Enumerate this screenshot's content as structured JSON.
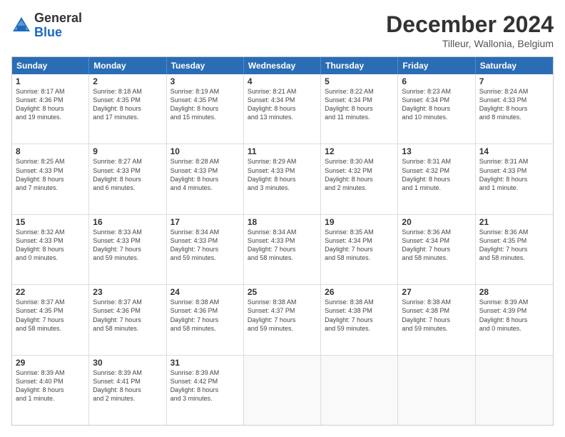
{
  "header": {
    "logo_general": "General",
    "logo_blue": "Blue",
    "month_title": "December 2024",
    "subtitle": "Tilleur, Wallonia, Belgium"
  },
  "days_of_week": [
    "Sunday",
    "Monday",
    "Tuesday",
    "Wednesday",
    "Thursday",
    "Friday",
    "Saturday"
  ],
  "weeks": [
    [
      {
        "day": "1",
        "lines": [
          "Sunrise: 8:17 AM",
          "Sunset: 4:36 PM",
          "Daylight: 8 hours",
          "and 19 minutes."
        ]
      },
      {
        "day": "2",
        "lines": [
          "Sunrise: 8:18 AM",
          "Sunset: 4:35 PM",
          "Daylight: 8 hours",
          "and 17 minutes."
        ]
      },
      {
        "day": "3",
        "lines": [
          "Sunrise: 8:19 AM",
          "Sunset: 4:35 PM",
          "Daylight: 8 hours",
          "and 15 minutes."
        ]
      },
      {
        "day": "4",
        "lines": [
          "Sunrise: 8:21 AM",
          "Sunset: 4:34 PM",
          "Daylight: 8 hours",
          "and 13 minutes."
        ]
      },
      {
        "day": "5",
        "lines": [
          "Sunrise: 8:22 AM",
          "Sunset: 4:34 PM",
          "Daylight: 8 hours",
          "and 11 minutes."
        ]
      },
      {
        "day": "6",
        "lines": [
          "Sunrise: 8:23 AM",
          "Sunset: 4:34 PM",
          "Daylight: 8 hours",
          "and 10 minutes."
        ]
      },
      {
        "day": "7",
        "lines": [
          "Sunrise: 8:24 AM",
          "Sunset: 4:33 PM",
          "Daylight: 8 hours",
          "and 8 minutes."
        ]
      }
    ],
    [
      {
        "day": "8",
        "lines": [
          "Sunrise: 8:25 AM",
          "Sunset: 4:33 PM",
          "Daylight: 8 hours",
          "and 7 minutes."
        ]
      },
      {
        "day": "9",
        "lines": [
          "Sunrise: 8:27 AM",
          "Sunset: 4:33 PM",
          "Daylight: 8 hours",
          "and 6 minutes."
        ]
      },
      {
        "day": "10",
        "lines": [
          "Sunrise: 8:28 AM",
          "Sunset: 4:33 PM",
          "Daylight: 8 hours",
          "and 4 minutes."
        ]
      },
      {
        "day": "11",
        "lines": [
          "Sunrise: 8:29 AM",
          "Sunset: 4:33 PM",
          "Daylight: 8 hours",
          "and 3 minutes."
        ]
      },
      {
        "day": "12",
        "lines": [
          "Sunrise: 8:30 AM",
          "Sunset: 4:32 PM",
          "Daylight: 8 hours",
          "and 2 minutes."
        ]
      },
      {
        "day": "13",
        "lines": [
          "Sunrise: 8:31 AM",
          "Sunset: 4:32 PM",
          "Daylight: 8 hours",
          "and 1 minute."
        ]
      },
      {
        "day": "14",
        "lines": [
          "Sunrise: 8:31 AM",
          "Sunset: 4:33 PM",
          "Daylight: 8 hours",
          "and 1 minute."
        ]
      }
    ],
    [
      {
        "day": "15",
        "lines": [
          "Sunrise: 8:32 AM",
          "Sunset: 4:33 PM",
          "Daylight: 8 hours",
          "and 0 minutes."
        ]
      },
      {
        "day": "16",
        "lines": [
          "Sunrise: 8:33 AM",
          "Sunset: 4:33 PM",
          "Daylight: 7 hours",
          "and 59 minutes."
        ]
      },
      {
        "day": "17",
        "lines": [
          "Sunrise: 8:34 AM",
          "Sunset: 4:33 PM",
          "Daylight: 7 hours",
          "and 59 minutes."
        ]
      },
      {
        "day": "18",
        "lines": [
          "Sunrise: 8:34 AM",
          "Sunset: 4:33 PM",
          "Daylight: 7 hours",
          "and 58 minutes."
        ]
      },
      {
        "day": "19",
        "lines": [
          "Sunrise: 8:35 AM",
          "Sunset: 4:34 PM",
          "Daylight: 7 hours",
          "and 58 minutes."
        ]
      },
      {
        "day": "20",
        "lines": [
          "Sunrise: 8:36 AM",
          "Sunset: 4:34 PM",
          "Daylight: 7 hours",
          "and 58 minutes."
        ]
      },
      {
        "day": "21",
        "lines": [
          "Sunrise: 8:36 AM",
          "Sunset: 4:35 PM",
          "Daylight: 7 hours",
          "and 58 minutes."
        ]
      }
    ],
    [
      {
        "day": "22",
        "lines": [
          "Sunrise: 8:37 AM",
          "Sunset: 4:35 PM",
          "Daylight: 7 hours",
          "and 58 minutes."
        ]
      },
      {
        "day": "23",
        "lines": [
          "Sunrise: 8:37 AM",
          "Sunset: 4:36 PM",
          "Daylight: 7 hours",
          "and 58 minutes."
        ]
      },
      {
        "day": "24",
        "lines": [
          "Sunrise: 8:38 AM",
          "Sunset: 4:36 PM",
          "Daylight: 7 hours",
          "and 58 minutes."
        ]
      },
      {
        "day": "25",
        "lines": [
          "Sunrise: 8:38 AM",
          "Sunset: 4:37 PM",
          "Daylight: 7 hours",
          "and 59 minutes."
        ]
      },
      {
        "day": "26",
        "lines": [
          "Sunrise: 8:38 AM",
          "Sunset: 4:38 PM",
          "Daylight: 7 hours",
          "and 59 minutes."
        ]
      },
      {
        "day": "27",
        "lines": [
          "Sunrise: 8:38 AM",
          "Sunset: 4:38 PM",
          "Daylight: 7 hours",
          "and 59 minutes."
        ]
      },
      {
        "day": "28",
        "lines": [
          "Sunrise: 8:39 AM",
          "Sunset: 4:39 PM",
          "Daylight: 8 hours",
          "and 0 minutes."
        ]
      }
    ],
    [
      {
        "day": "29",
        "lines": [
          "Sunrise: 8:39 AM",
          "Sunset: 4:40 PM",
          "Daylight: 8 hours",
          "and 1 minute."
        ]
      },
      {
        "day": "30",
        "lines": [
          "Sunrise: 8:39 AM",
          "Sunset: 4:41 PM",
          "Daylight: 8 hours",
          "and 2 minutes."
        ]
      },
      {
        "day": "31",
        "lines": [
          "Sunrise: 8:39 AM",
          "Sunset: 4:42 PM",
          "Daylight: 8 hours",
          "and 3 minutes."
        ]
      },
      null,
      null,
      null,
      null
    ]
  ]
}
